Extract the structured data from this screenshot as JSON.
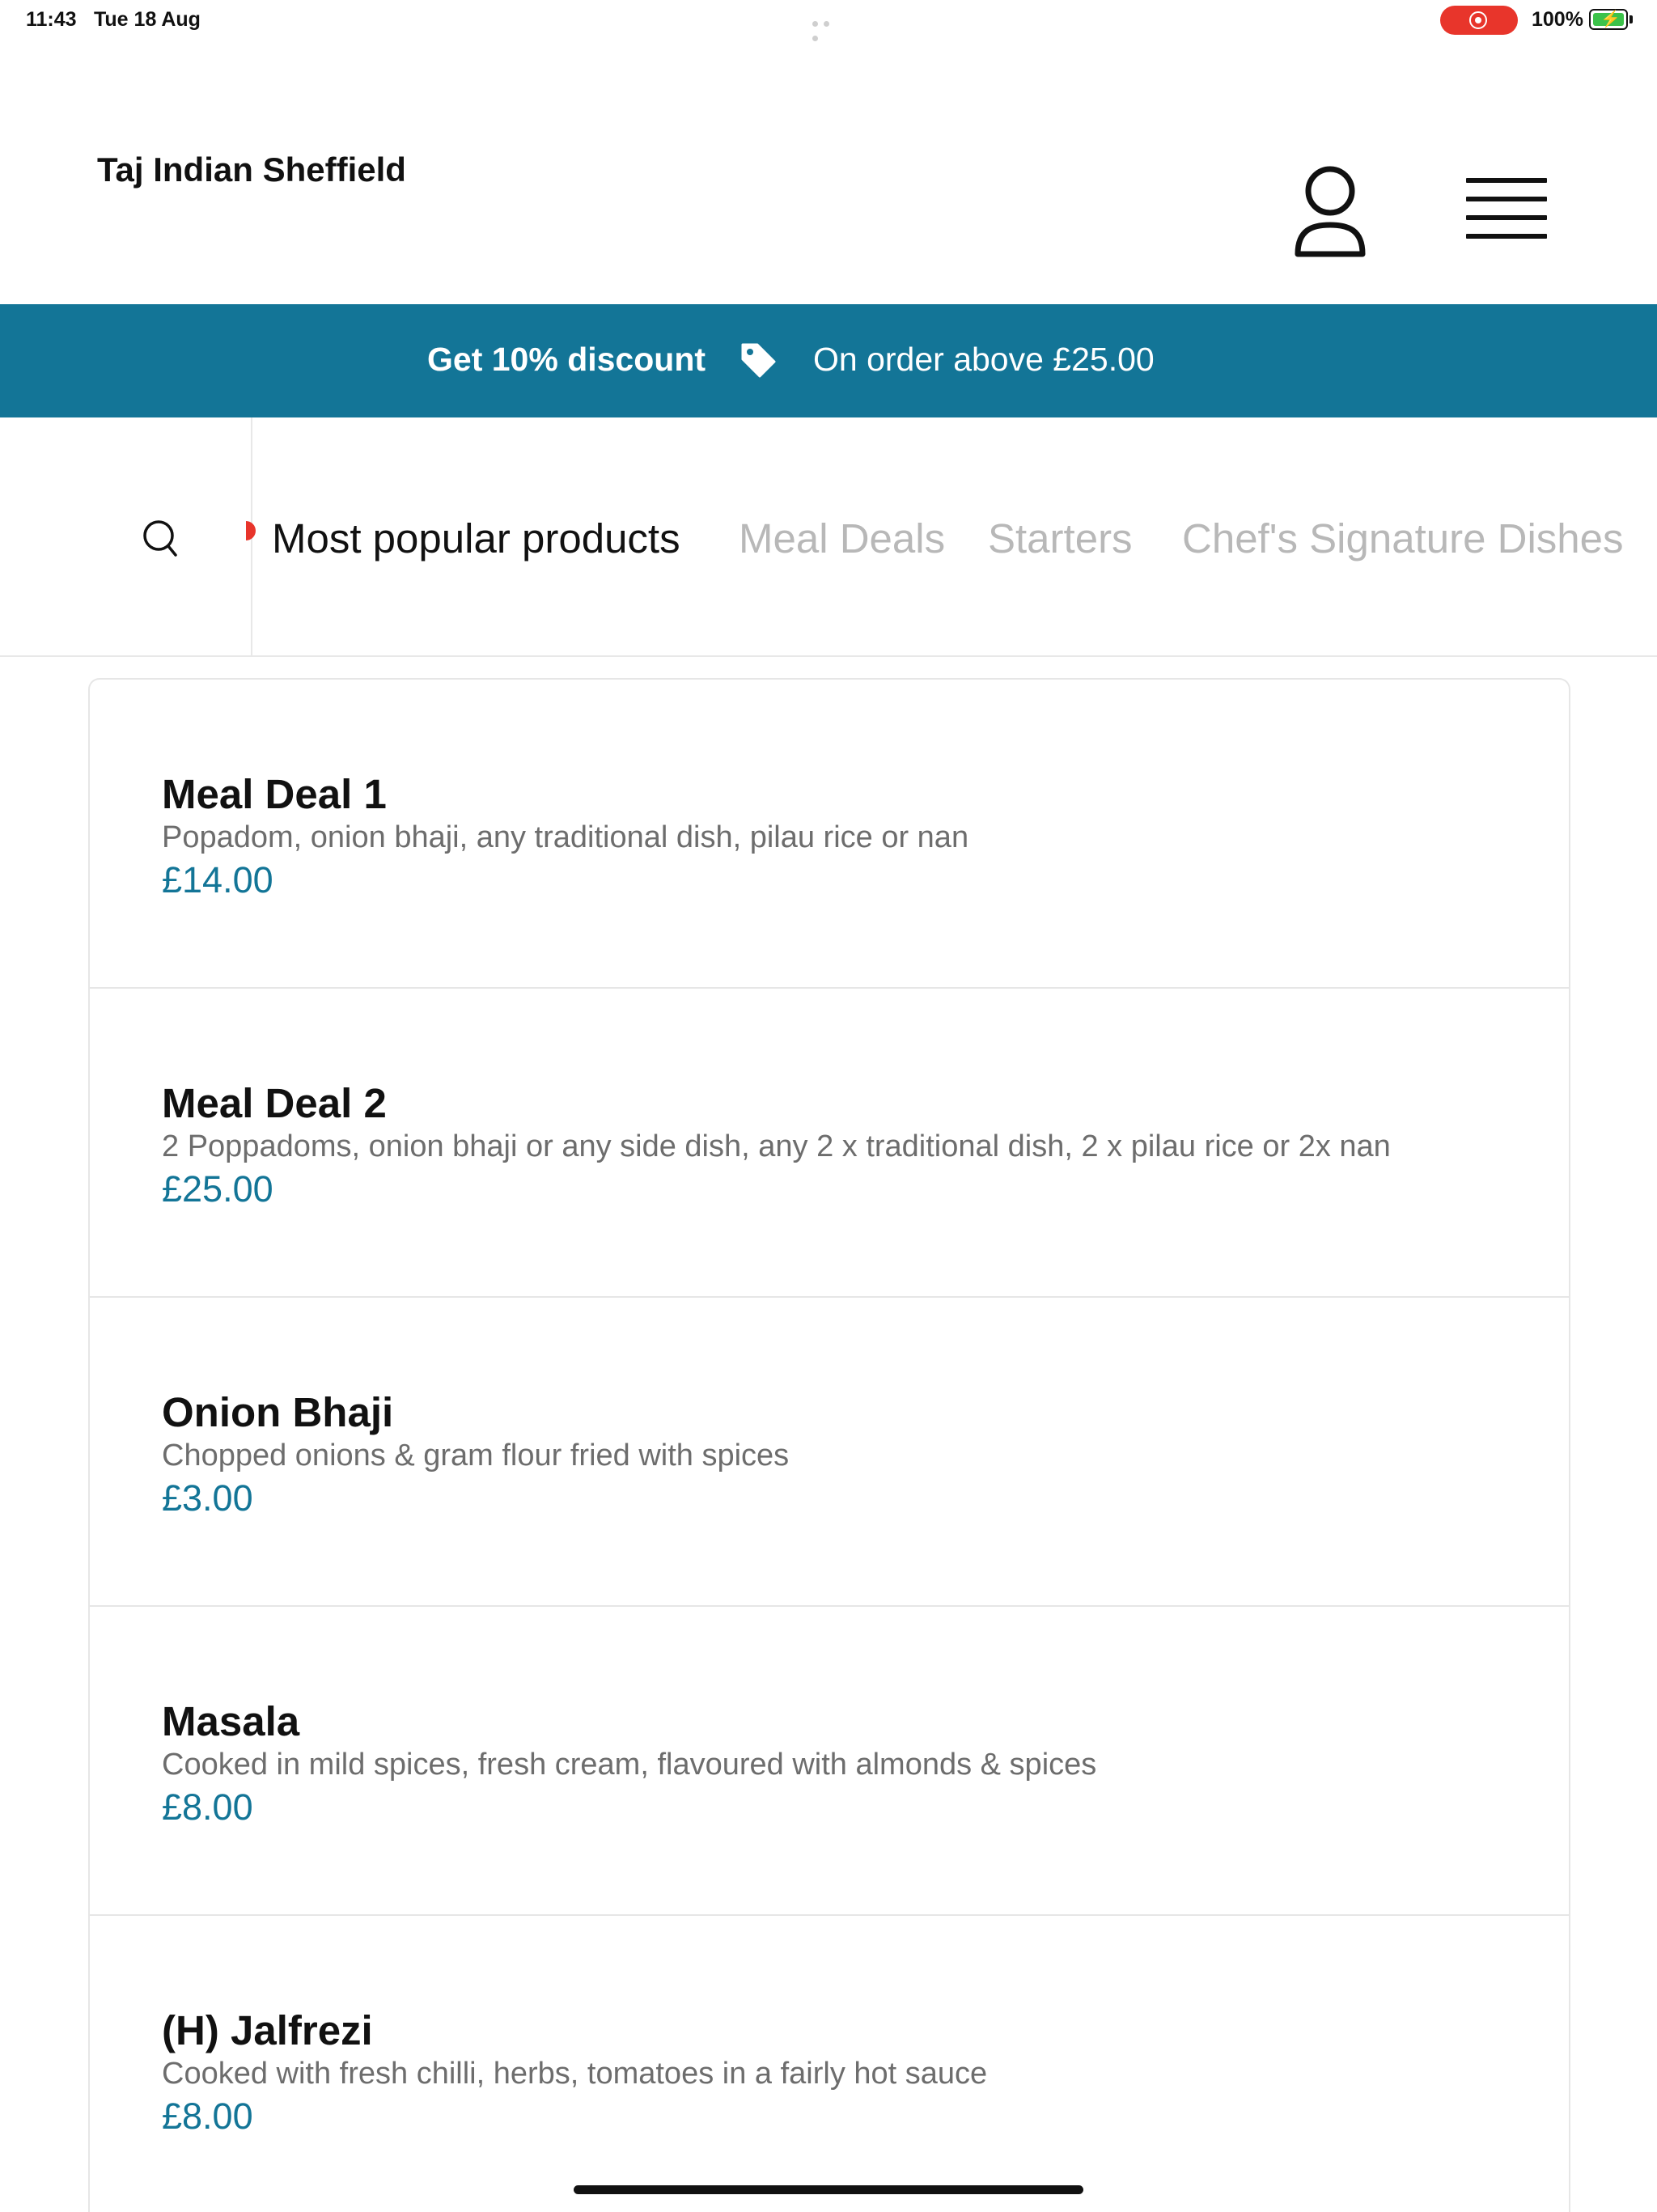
{
  "status_bar": {
    "time": "11:43",
    "date": "Tue 18 Aug",
    "battery": "100%"
  },
  "header": {
    "title": "Taj Indian Sheffield",
    "icons": [
      "user-icon",
      "menu-icon"
    ]
  },
  "promo": {
    "discount": "Get 10% discount",
    "condition": "On order above £25.00",
    "icon": "tag-icon",
    "color": "#137597"
  },
  "tabs": [
    {
      "label": "Most popular products",
      "active": true
    },
    {
      "label": "Meal Deals",
      "active": false
    },
    {
      "label": "Starters",
      "active": false
    },
    {
      "label": "Chef's Signature Dishes",
      "active": false
    }
  ],
  "products": [
    {
      "name": "Meal Deal 1",
      "description": "Popadom, onion bhaji, any traditional dish, pilau rice or nan",
      "price": "£14.00"
    },
    {
      "name": "Meal Deal 2",
      "description": "2 Poppadoms, onion bhaji or any side dish, any 2 x traditional dish, 2 x pilau rice or 2x nan",
      "price": "£25.00"
    },
    {
      "name": "Onion Bhaji",
      "description": "Chopped onions & gram flour fried with spices",
      "price": "£3.00"
    },
    {
      "name": "Masala",
      "description": "Cooked in mild spices, fresh cream, flavoured with almonds & spices",
      "price": "£8.00"
    },
    {
      "name": "(H) Jalfrezi",
      "description": "Cooked with fresh chilli, herbs, tomatoes in a fairly hot sauce",
      "price": "£8.00"
    }
  ],
  "colors": {
    "accent": "#137597",
    "recording": "#e8352b",
    "muted_text": "#6d6d6d"
  }
}
